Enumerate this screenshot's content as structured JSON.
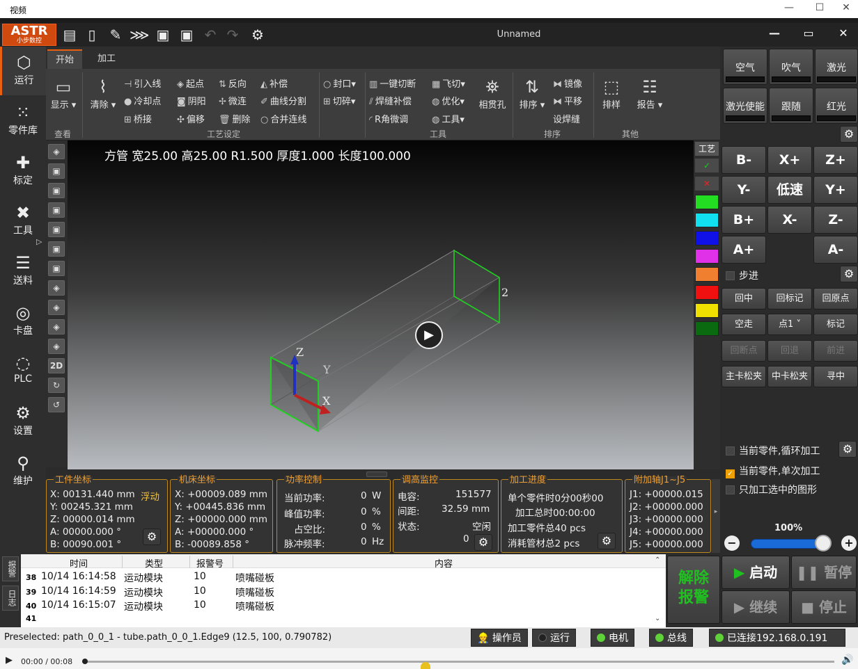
{
  "window": {
    "title": "视频",
    "minimize": "—",
    "maximize": "☐",
    "close": "✕"
  },
  "app": {
    "logo_main": "ASTR",
    "logo_sub": "小步数控",
    "document_title": "Unnamed",
    "controls": {
      "min": "—",
      "max": "▭",
      "close": "✕"
    }
  },
  "left_nav": [
    {
      "label": "运行",
      "icon": "cube-icon"
    },
    {
      "label": "零件库",
      "icon": "grid-dots-icon"
    },
    {
      "label": "标定",
      "icon": "crosshair-icon"
    },
    {
      "label": "工具",
      "icon": "tools-icon"
    },
    {
      "label": "送料",
      "icon": "feed-icon"
    },
    {
      "label": "卡盘",
      "icon": "chuck-icon"
    },
    {
      "label": "PLC",
      "icon": "plc-icon"
    },
    {
      "label": "设置",
      "icon": "gear-icon"
    },
    {
      "label": "维护",
      "icon": "wrench-icon"
    }
  ],
  "ribbon": {
    "tabs": [
      "开始",
      "加工"
    ],
    "view": {
      "display": "显示",
      "group": "查看"
    },
    "process": {
      "clear": "清除",
      "items": [
        "引入线",
        "冷却点",
        "桥接",
        "起点",
        "阴阳",
        "偏移",
        "反向",
        "微连",
        "删除",
        "补偿",
        "曲线分割",
        "合并连线"
      ],
      "group": "工艺设定"
    },
    "tools": {
      "items": [
        "封口",
        "切碎",
        "一键切断",
        "焊缝补偿",
        "R角微调",
        "飞切",
        "优化",
        "工具"
      ],
      "hole": "相贯孔",
      "group": "工具"
    },
    "sort": {
      "sort": "排序",
      "items": [
        "镜像",
        "平移",
        "设焊缝"
      ],
      "group": "排序"
    },
    "other": {
      "layout": "排样",
      "report": "报告",
      "group": "其他"
    }
  },
  "viewport": {
    "info": "方管 宽25.00 高25.00 R1.500 厚度1.000 长度100.000",
    "label_2": "2",
    "axis_z": "Z",
    "axis_y": "Y",
    "axis_x": "X",
    "view_tool_2d": "2D"
  },
  "palette": {
    "title": "工艺",
    "check": "✓",
    "cross": "✕",
    "colors": [
      "#22dd22",
      "#10e0f0",
      "#1010e8",
      "#e030e8",
      "#f08030",
      "#f01010",
      "#f0e000",
      "#0a6a10"
    ]
  },
  "right_panel": {
    "toggles": [
      {
        "label": "空气"
      },
      {
        "label": "吹气"
      },
      {
        "label": "激光"
      },
      {
        "label": "激光使能"
      },
      {
        "label": "跟随"
      },
      {
        "label": "红光"
      }
    ],
    "jog": [
      "B-",
      "X+",
      "Z+",
      "Y-",
      "低速",
      "Y+",
      "B+",
      "X-",
      "Z-",
      "A+",
      "",
      "A-"
    ],
    "step": "步进",
    "actions": [
      {
        "label": "回中",
        "disabled": false
      },
      {
        "label": "回标记",
        "disabled": false
      },
      {
        "label": "回原点",
        "disabled": false
      },
      {
        "label": "空走",
        "disabled": false
      },
      {
        "label": "点1",
        "disabled": false
      },
      {
        "label": "标记",
        "disabled": false
      },
      {
        "label": "回断点",
        "disabled": true
      },
      {
        "label": "回退",
        "disabled": true
      },
      {
        "label": "前进",
        "disabled": true
      },
      {
        "label": "主卡松夹",
        "disabled": false
      },
      {
        "label": "中卡松夹",
        "disabled": false
      },
      {
        "label": "寻中",
        "disabled": false
      }
    ],
    "options": [
      {
        "label": "当前零件,循环加工",
        "checked": false
      },
      {
        "label": "当前零件,单次加工",
        "checked": true
      },
      {
        "label": "只加工选中的图形",
        "checked": false
      }
    ],
    "speed": "100%",
    "speed_value": 0.85,
    "minus": "−",
    "plus": "+"
  },
  "panels": {
    "work": {
      "title": "工件坐标",
      "x": "X: 00131.440 mm",
      "float": "浮动",
      "y": "Y: 00245.321 mm",
      "z": "Z: 00000.014 mm",
      "a": "A: 00000.000 °",
      "b": "B: 00090.001 °"
    },
    "machine": {
      "title": "机床坐标",
      "x": "X: +00009.089 mm",
      "y": "Y: +00445.836 mm",
      "z": "Z: +00000.000 mm",
      "a": "A: +00000.000 °",
      "b": "B:  -00089.858 °"
    },
    "power": {
      "title": "功率控制",
      "rows": [
        {
          "k": "当前功率:",
          "v": "0",
          "u": "W"
        },
        {
          "k": "峰值功率:",
          "v": "0",
          "u": "%"
        },
        {
          "k": "占空比:",
          "v": "0",
          "u": "%"
        },
        {
          "k": "脉冲频率:",
          "v": "0",
          "u": "Hz"
        }
      ]
    },
    "height": {
      "title": "调高监控",
      "cap_k": "电容:",
      "cap_v": "151577",
      "gap_k": "间距:",
      "gap_v": "32.59  mm",
      "state_k": "状态:",
      "state_v": "空闲",
      "count": "0"
    },
    "progress": {
      "title": "加工进度",
      "l1": "单个零件时0分00秒00",
      "l2": "加工总时00:00:00",
      "l3": "加工零件总40 pcs",
      "l4": "消耗管材总2 pcs"
    },
    "aux": {
      "title": "附加轴J1~J5",
      "rows": [
        "J1: +00000.015",
        "J2: +00000.000",
        "J3: +00000.000",
        "J4: +00000.000",
        "J5: +00000.000"
      ]
    }
  },
  "log": {
    "tabs": [
      "报警",
      "日志"
    ],
    "headers": [
      "时间",
      "类型",
      "报警号",
      "内容"
    ],
    "rows": [
      {
        "n": "38",
        "time": "10/14 16:14:58",
        "type": "运动模块",
        "code": "10",
        "content": "喷嘴碰板"
      },
      {
        "n": "39",
        "time": "10/14 16:14:59",
        "type": "运动模块",
        "code": "10",
        "content": "喷嘴碰板"
      },
      {
        "n": "40",
        "time": "10/14 16:15:07",
        "type": "运动模块",
        "code": "10",
        "content": "喷嘴碰板"
      },
      {
        "n": "41",
        "time": "",
        "type": "",
        "code": "",
        "content": ""
      }
    ]
  },
  "run": {
    "clear_alarm_1": "解除",
    "clear_alarm_2": "报警",
    "start": "启动",
    "pause": "暂停",
    "continue": "继续",
    "stop": "停止"
  },
  "status": {
    "preselect": "Preselected: path_0_0_1 - tube.path_0_0_1.Edge9 (12.5, 100, 0.790782)",
    "operator": "操作员",
    "running": "运行",
    "motor": "电机",
    "bus": "总线",
    "connected": "已连接192.168.0.191"
  },
  "video": {
    "time": "00:00 / 00:08"
  }
}
